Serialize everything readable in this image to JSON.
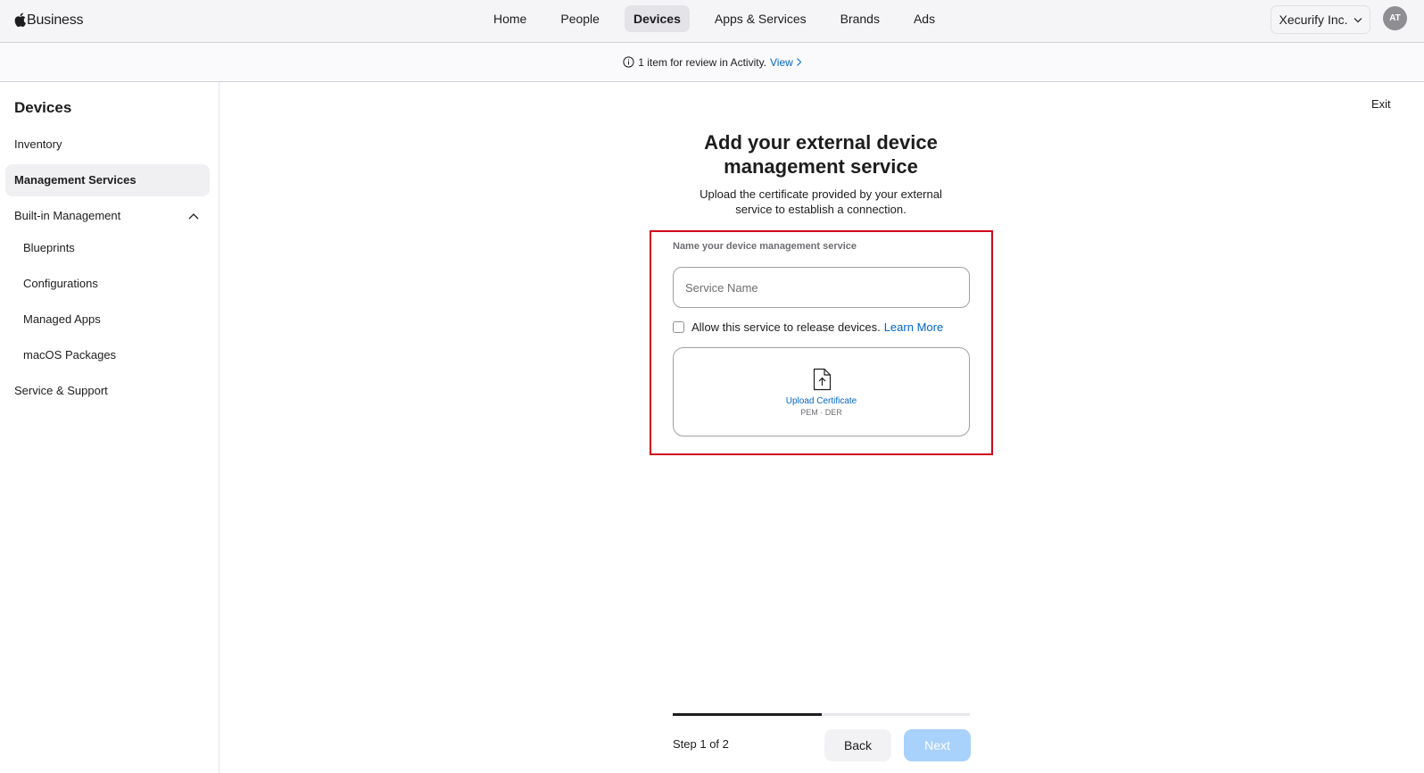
{
  "brand": {
    "name": "Business",
    "logo_icon": "apple-logo-icon"
  },
  "nav": {
    "tabs": [
      {
        "label": "Home",
        "active": false
      },
      {
        "label": "People",
        "active": false
      },
      {
        "label": "Devices",
        "active": true
      },
      {
        "label": "Apps & Services",
        "active": false
      },
      {
        "label": "Brands",
        "active": false
      },
      {
        "label": "Ads",
        "active": false
      }
    ],
    "org": "Xecurify Inc.",
    "avatar_initials": "AT"
  },
  "banner": {
    "text": "1 item for review in Activity.",
    "link": "View"
  },
  "sidebar": {
    "title": "Devices",
    "items": [
      {
        "label": "Inventory"
      },
      {
        "label": "Management Services",
        "active": true
      },
      {
        "label": "Built-in Management",
        "expanded": true
      },
      {
        "label": "Blueprints"
      },
      {
        "label": "Configurations"
      },
      {
        "label": "Managed Apps"
      },
      {
        "label": "macOS Packages"
      },
      {
        "label": "Service & Support"
      }
    ]
  },
  "main": {
    "exit_label": "Exit",
    "heading_line1": "Add your external device",
    "heading_line2": "management service",
    "subheading_line1": "Upload the certificate provided by your external",
    "subheading_line2": "service to establish a connection.",
    "field_label": "Name your device management service",
    "service_name_placeholder": "Service Name",
    "service_name_value": "",
    "allow_release_label": "Allow this service to release devices.",
    "allow_release_checked": false,
    "learn_more": "Learn More",
    "upload_label": "Upload Certificate",
    "upload_formats": "PEM · DER",
    "highlight_color": "#d0021b"
  },
  "footer": {
    "progress_fraction": 0.5,
    "step_text": "Step 1 of 2",
    "back_label": "Back",
    "next_label": "Next",
    "next_enabled": false
  },
  "colors": {
    "accent": "#0066cc",
    "next_disabled": "#a8d1fb"
  }
}
